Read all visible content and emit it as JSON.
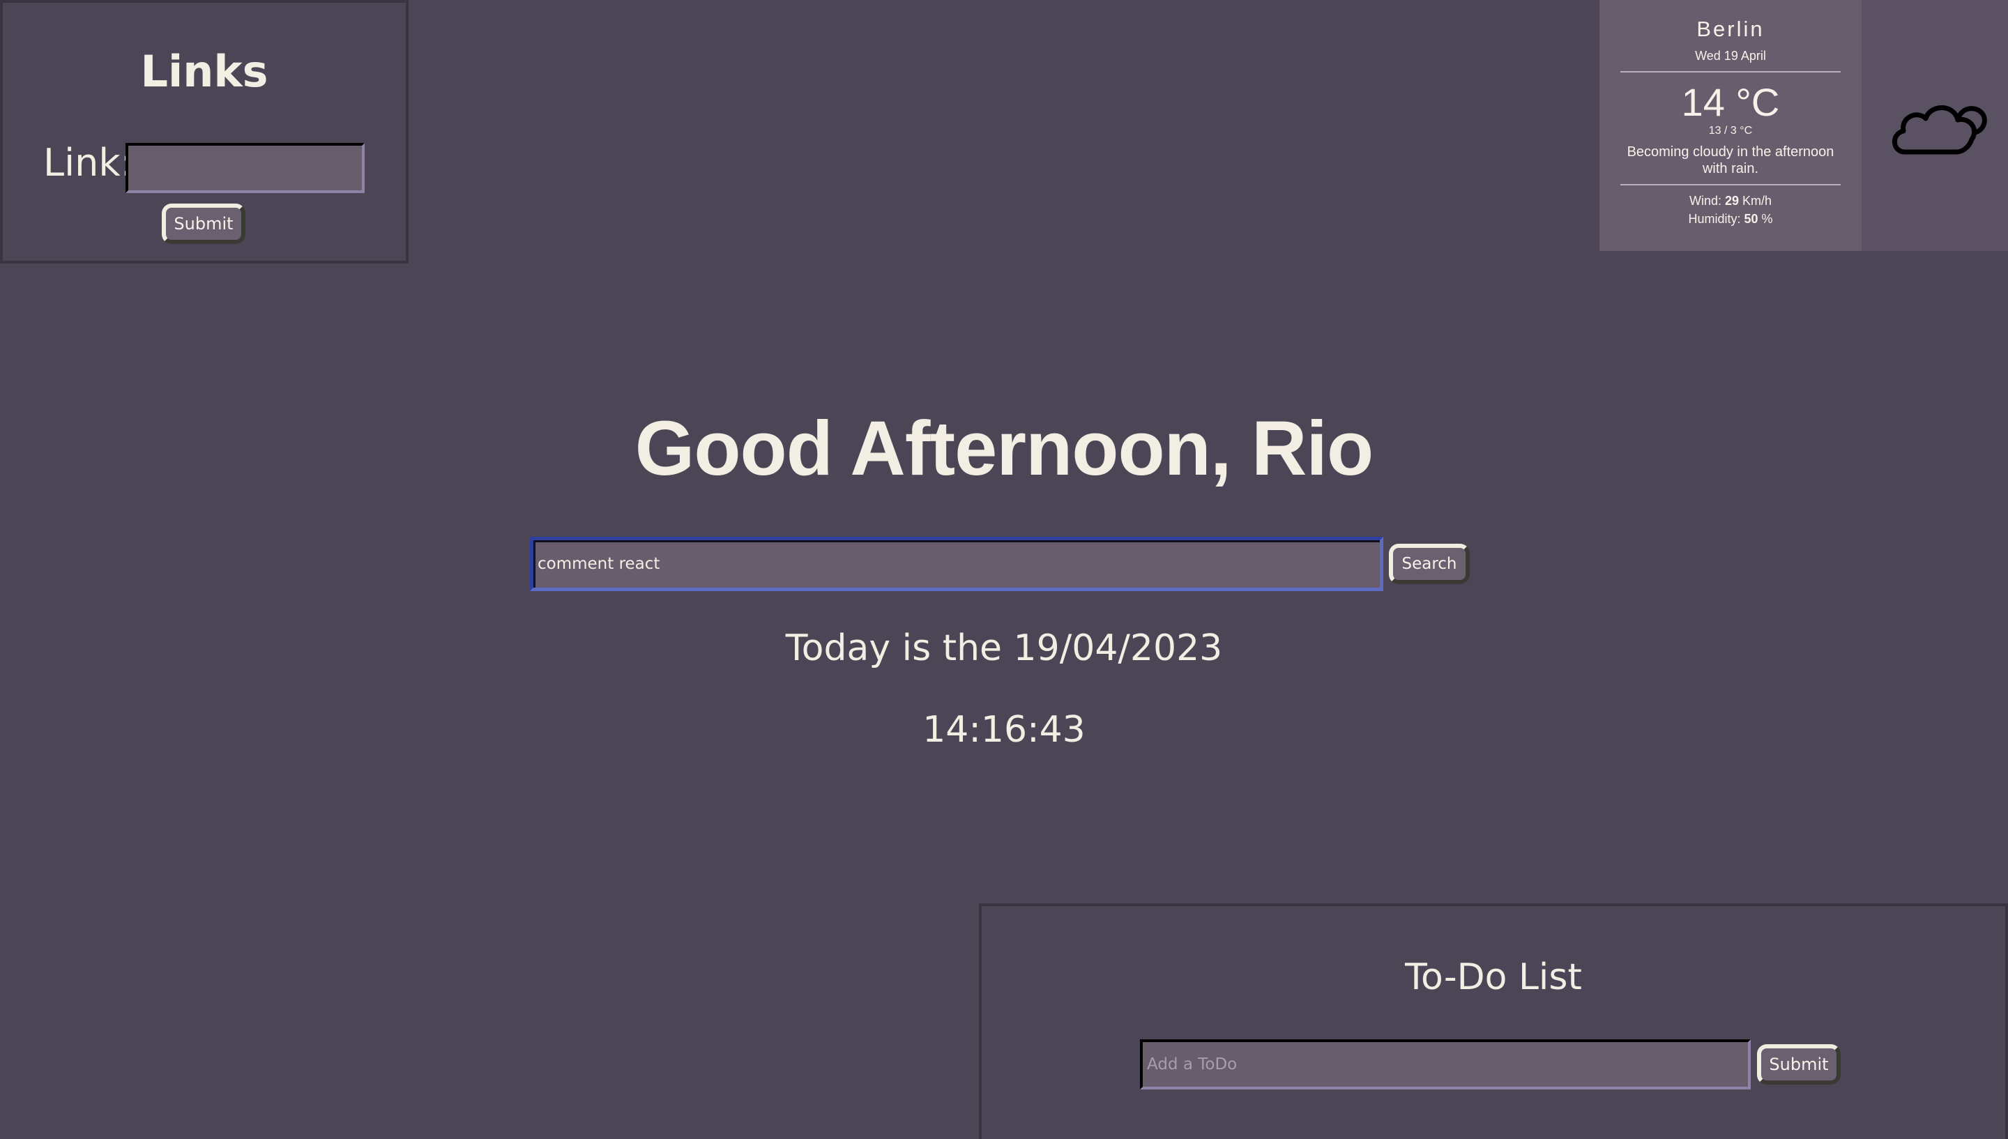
{
  "links": {
    "title": "Links",
    "label": "Link:",
    "input_value": "",
    "submit_label": "Submit"
  },
  "weather": {
    "city": "Berlin",
    "date": "Wed 19 April",
    "temperature": "14 °C",
    "min_max": "13 / 3 °C",
    "description": "Becoming cloudy in the afternoon with rain.",
    "wind_label": "Wind:",
    "wind_value": "29",
    "wind_unit": "Km/h",
    "humidity_label": "Humidity:",
    "humidity_value": "50",
    "humidity_unit": "%",
    "icon": "cloud-icon"
  },
  "greeting": "Good Afternoon, Rio",
  "search": {
    "value": "comment react",
    "button_label": "Search"
  },
  "today": "Today is the 19/04/2023",
  "clock": "14:16:43",
  "todo": {
    "title": "To-Do List",
    "placeholder": "Add a ToDo",
    "submit_label": "Submit"
  },
  "colors": {
    "background": "#4c4556",
    "panel": "#675d6d",
    "text": "#f3eee3",
    "search_focus": "#2d40a0"
  }
}
